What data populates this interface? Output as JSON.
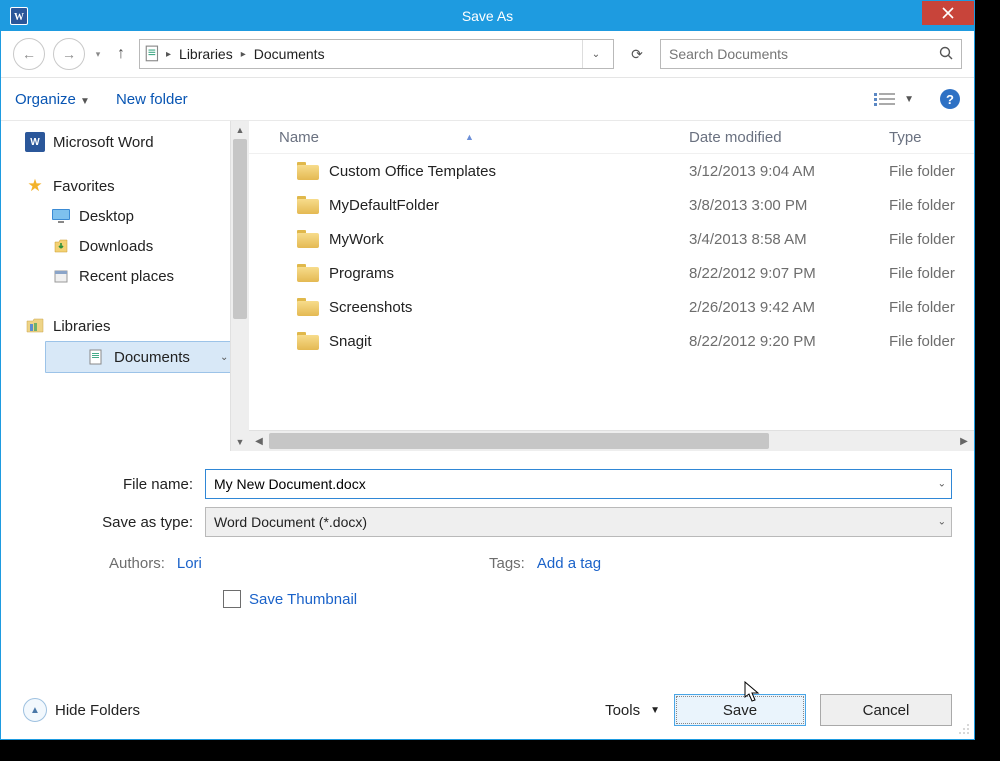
{
  "title": "Save As",
  "breadcrumb": {
    "level1": "Libraries",
    "level2": "Documents"
  },
  "search": {
    "placeholder": "Search Documents"
  },
  "toolbar": {
    "organize": "Organize",
    "newfolder": "New folder"
  },
  "sidebar": {
    "msword": "Microsoft Word",
    "favorites": "Favorites",
    "desktop": "Desktop",
    "downloads": "Downloads",
    "recent": "Recent places",
    "libraries": "Libraries",
    "documents": "Documents"
  },
  "columns": {
    "name": "Name",
    "date": "Date modified",
    "type": "Type"
  },
  "files": [
    {
      "name": "Custom Office Templates",
      "date": "3/12/2013 9:04 AM",
      "type": "File folder"
    },
    {
      "name": "MyDefaultFolder",
      "date": "3/8/2013 3:00 PM",
      "type": "File folder"
    },
    {
      "name": "MyWork",
      "date": "3/4/2013 8:58 AM",
      "type": "File folder"
    },
    {
      "name": "Programs",
      "date": "8/22/2012 9:07 PM",
      "type": "File folder"
    },
    {
      "name": "Screenshots",
      "date": "2/26/2013 9:42 AM",
      "type": "File folder"
    },
    {
      "name": "Snagit",
      "date": "8/22/2012 9:20 PM",
      "type": "File folder"
    }
  ],
  "form": {
    "filename_label": "File name:",
    "filename_value": "My New Document.docx",
    "type_label": "Save as type:",
    "type_value": "Word Document (*.docx)",
    "authors_label": "Authors:",
    "authors_value": "Lori",
    "tags_label": "Tags:",
    "tags_value": "Add a tag",
    "thumbnail": "Save Thumbnail"
  },
  "footer": {
    "hidefolders": "Hide Folders",
    "tools": "Tools",
    "save": "Save",
    "cancel": "Cancel"
  }
}
